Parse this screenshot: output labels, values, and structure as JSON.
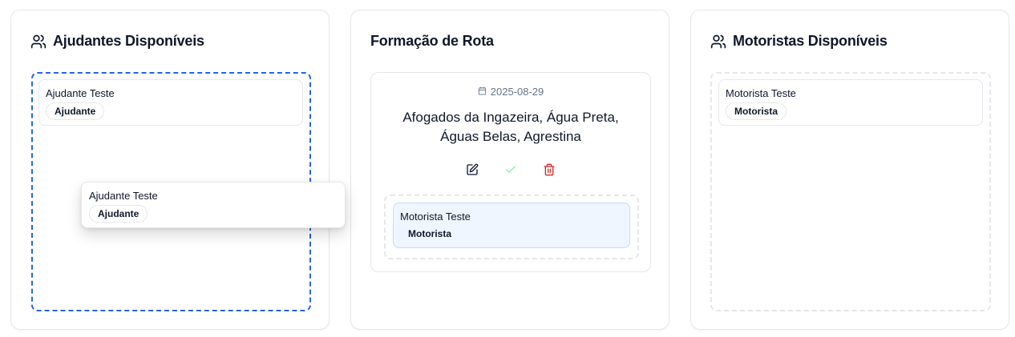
{
  "helpers_panel": {
    "title": "Ajudantes Disponíveis",
    "icon": "users-icon",
    "items": [
      {
        "name": "Ajudante Teste",
        "role": "Ajudante"
      }
    ],
    "dropzone_color": "#2563eb"
  },
  "dragging_item": {
    "name": "Ajudante Teste",
    "role": "Ajudante"
  },
  "route_panel": {
    "title": "Formação de Rota",
    "route": {
      "date": "2025-08-29",
      "cities_line1": "Afogados da Ingazeira, Água Preta,",
      "cities_line2": "Águas Belas, Agrestina",
      "actions": [
        "edit-icon",
        "check-icon",
        "trash-icon"
      ],
      "assigned": [
        {
          "name": "Motorista Teste",
          "role": "Motorista"
        }
      ]
    }
  },
  "drivers_panel": {
    "title": "Motoristas Disponíveis",
    "icon": "users-icon",
    "items": [
      {
        "name": "Motorista Teste",
        "role": "Motorista"
      }
    ]
  },
  "colors": {
    "accent": "#2563eb",
    "success": "#22c55e",
    "danger": "#dc2626",
    "muted": "#64748b",
    "assigned_bg": "#eff6ff"
  }
}
